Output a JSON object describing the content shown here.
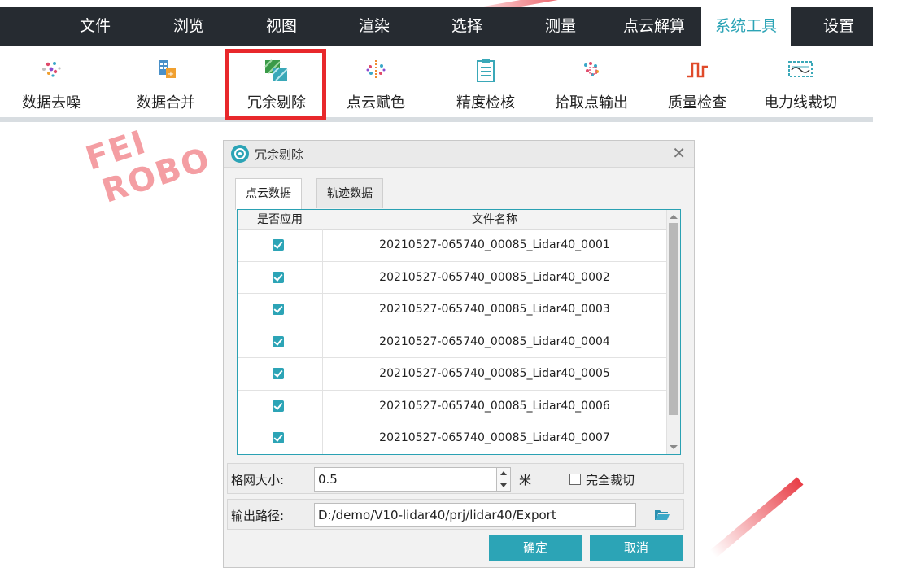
{
  "menubar": {
    "items": [
      "文件",
      "浏览",
      "视图",
      "渲染",
      "选择",
      "测量",
      "点云解算",
      "系统工具",
      "设置"
    ],
    "active_index": 7
  },
  "ribbon": {
    "tools": [
      {
        "label": "数据去噪",
        "icon": "scatter-dots-icon"
      },
      {
        "label": "数据合并",
        "icon": "data-merge-icon"
      },
      {
        "label": "冗余剔除",
        "icon": "redundancy-removal-icon"
      },
      {
        "label": "点云赋色",
        "icon": "colored-points-icon"
      },
      {
        "label": "精度检核",
        "icon": "clipboard-check-icon"
      },
      {
        "label": "拾取点输出",
        "icon": "pick-points-icon"
      },
      {
        "label": "质量检查",
        "icon": "pulse-wave-icon"
      },
      {
        "label": "电力线裁切",
        "icon": "powerline-cut-icon"
      }
    ],
    "highlighted": "冗余剔除"
  },
  "watermark": {
    "line1": "FEI",
    "line2": "ROBO"
  },
  "dialog": {
    "title": "冗余剔除",
    "close_glyph": "✕",
    "tabs": [
      "点云数据",
      "轨迹数据"
    ],
    "active_tab": 0,
    "table": {
      "columns": [
        "是否应用",
        "文件名称"
      ],
      "rows": [
        {
          "applied": true,
          "name": "20210527-065740_00085_Lidar40_0001"
        },
        {
          "applied": true,
          "name": "20210527-065740_00085_Lidar40_0002"
        },
        {
          "applied": true,
          "name": "20210527-065740_00085_Lidar40_0003"
        },
        {
          "applied": true,
          "name": "20210527-065740_00085_Lidar40_0004"
        },
        {
          "applied": true,
          "name": "20210527-065740_00085_Lidar40_0005"
        },
        {
          "applied": true,
          "name": "20210527-065740_00085_Lidar40_0006"
        },
        {
          "applied": true,
          "name": "20210527-065740_00085_Lidar40_0007"
        }
      ]
    },
    "grid_size": {
      "label": "格网大小:",
      "value": "0.5",
      "unit": "米"
    },
    "full_clip": {
      "label": "完全裁切",
      "checked": false
    },
    "output_path": {
      "label": "输出路径:",
      "value": "D:/demo/V10-lidar40/prj/lidar40/Export"
    },
    "ok_label": "确定",
    "cancel_label": "取消"
  },
  "colors": {
    "accent": "#2ca4b6",
    "menubar": "#262b31",
    "highlight": "#e8282b"
  }
}
